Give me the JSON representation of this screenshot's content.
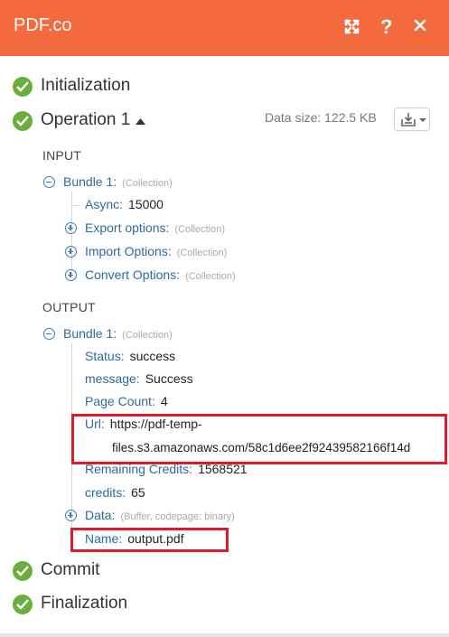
{
  "header": {
    "title": "PDF.co",
    "icons": [
      "expand-icon",
      "help-icon",
      "close-icon"
    ],
    "accent": "#f26a3d"
  },
  "stages": {
    "initialization": "Initialization",
    "operation": "Operation 1",
    "commit": "Commit",
    "finalization": "Finalization"
  },
  "operation": {
    "data_size": "Data size: 122.5 KB"
  },
  "input": {
    "section_label": "INPUT",
    "bundle_label": "Bundle 1:",
    "bundle_meta": "(Collection)",
    "async_key": "Async:",
    "async_val": "15000",
    "export_key": "Export options:",
    "export_meta": "(Collection)",
    "import_key": "Import Options:",
    "import_meta": "(Collection)",
    "convert_key": "Convert Options:",
    "convert_meta": "(Collection)"
  },
  "output": {
    "section_label": "OUTPUT",
    "bundle_label": "Bundle 1:",
    "bundle_meta": "(Collection)",
    "status_key": "Status:",
    "status_val": "success",
    "message_key": "message:",
    "message_val": "Success",
    "pagecount_key": "Page Count:",
    "pagecount_val": "4",
    "url_key": "Url:",
    "url_line1": "https://pdf-temp-",
    "url_line2": "files.s3.amazonaws.com/58c1d6ee2f92439582166f14d",
    "credits_rem_key": "Remaining Credits:",
    "credits_rem_val": "1568521",
    "credits_key": "credits:",
    "credits_val": "65",
    "data_key": "Data:",
    "data_meta": "(Buffer, codepage: binary)",
    "name_key": "Name:",
    "name_val": "output.pdf"
  },
  "colors": {
    "success": "#6aaf3d",
    "highlight": "#e0192d",
    "key": "#2d6a9f"
  }
}
